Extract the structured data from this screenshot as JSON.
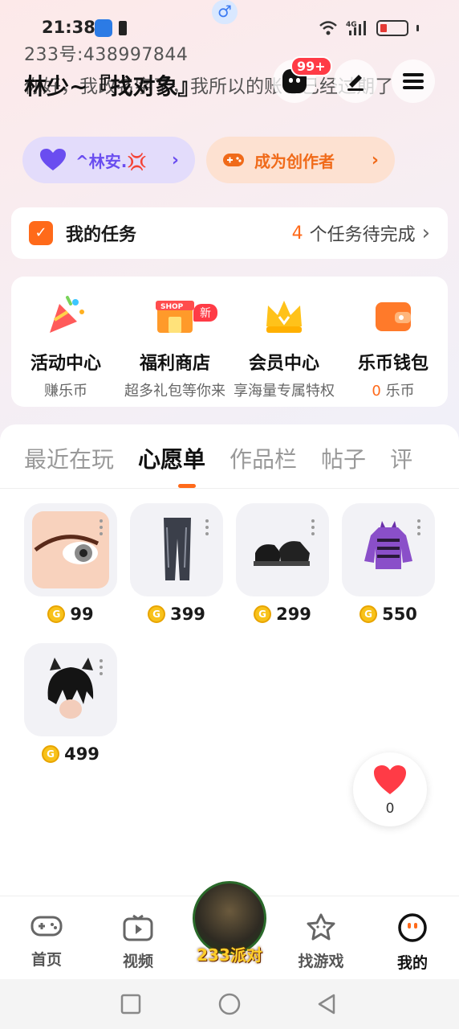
{
  "status_bar": {
    "time": "21:38",
    "network": "4G"
  },
  "profile": {
    "user_id": "233号:438997844",
    "nickname": "林少~『找对象』",
    "bio": "你好，我改名字了，我所以的账号已经过期了",
    "message_badge": "99+"
  },
  "pills": {
    "friend_label": "^林安.💢",
    "creator_label": "成为创作者"
  },
  "tasks": {
    "title": "我的任务",
    "count": "4",
    "suffix": "个任务待完成"
  },
  "services": [
    {
      "name": "活动中心",
      "sub": "赚乐币",
      "icon": "party-popper-icon"
    },
    {
      "name": "福利商店",
      "sub": "超多礼包等你来",
      "icon": "shop-icon",
      "badge": "新"
    },
    {
      "name": "会员中心",
      "sub": "享海量专属特权",
      "icon": "crown-icon"
    },
    {
      "name": "乐币钱包",
      "sub_value": "0",
      "sub_unit": "乐币",
      "icon": "wallet-icon"
    }
  ],
  "tabs": [
    "最近在玩",
    "心愿单",
    "作品栏",
    "帖子",
    "评"
  ],
  "active_tab": "心愿单",
  "wishlist": [
    {
      "name": "eye-item",
      "price": "99"
    },
    {
      "name": "jeans-item",
      "price": "399"
    },
    {
      "name": "shoes-item",
      "price": "299"
    },
    {
      "name": "hoodie-item",
      "price": "550"
    },
    {
      "name": "hair-item",
      "price": "499"
    }
  ],
  "like": {
    "count": "0"
  },
  "bottom_nav": [
    {
      "label": "首页",
      "icon": "gamepad-icon"
    },
    {
      "label": "视频",
      "icon": "video-icon"
    },
    {
      "label": "233派对",
      "icon": "party-avatar-icon"
    },
    {
      "label": "找游戏",
      "icon": "star-icon"
    },
    {
      "label": "我的",
      "icon": "me-icon"
    }
  ],
  "colors": {
    "accent": "#ff6a1a",
    "friend": "#6a4df0",
    "badge": "#ff3b46"
  }
}
